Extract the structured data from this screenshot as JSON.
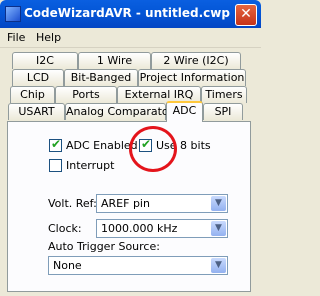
{
  "window": {
    "title": "CodeWizardAVR - untitled.cwp",
    "close": "✕"
  },
  "menu": [
    "File",
    "Help"
  ],
  "tabs": {
    "row1": [
      "I2C",
      "1 Wire",
      "2 Wire (I2C)"
    ],
    "row2": [
      "LCD",
      "Bit-Banged",
      "Project Information"
    ],
    "row3": [
      "Chip",
      "Ports",
      "External IRQ",
      "Timers"
    ],
    "row4": [
      "USART",
      "Analog Comparator",
      "ADC",
      "SPI"
    ],
    "active": "ADC"
  },
  "adc": {
    "adc_enabled": {
      "label": "ADC Enabled",
      "checked": true
    },
    "use_8_bits": {
      "label": "Use 8 bits",
      "checked": true
    },
    "interrupt": {
      "label": "Interrupt",
      "checked": false
    },
    "volt_ref": {
      "label": "Volt. Ref:",
      "value": "AREF pin"
    },
    "clock": {
      "label": "Clock:",
      "value": "1000.000 kHz"
    },
    "auto_trigger": {
      "label": "Auto Trigger Source:",
      "value": "None"
    }
  },
  "highlight_color": "#e4141b"
}
